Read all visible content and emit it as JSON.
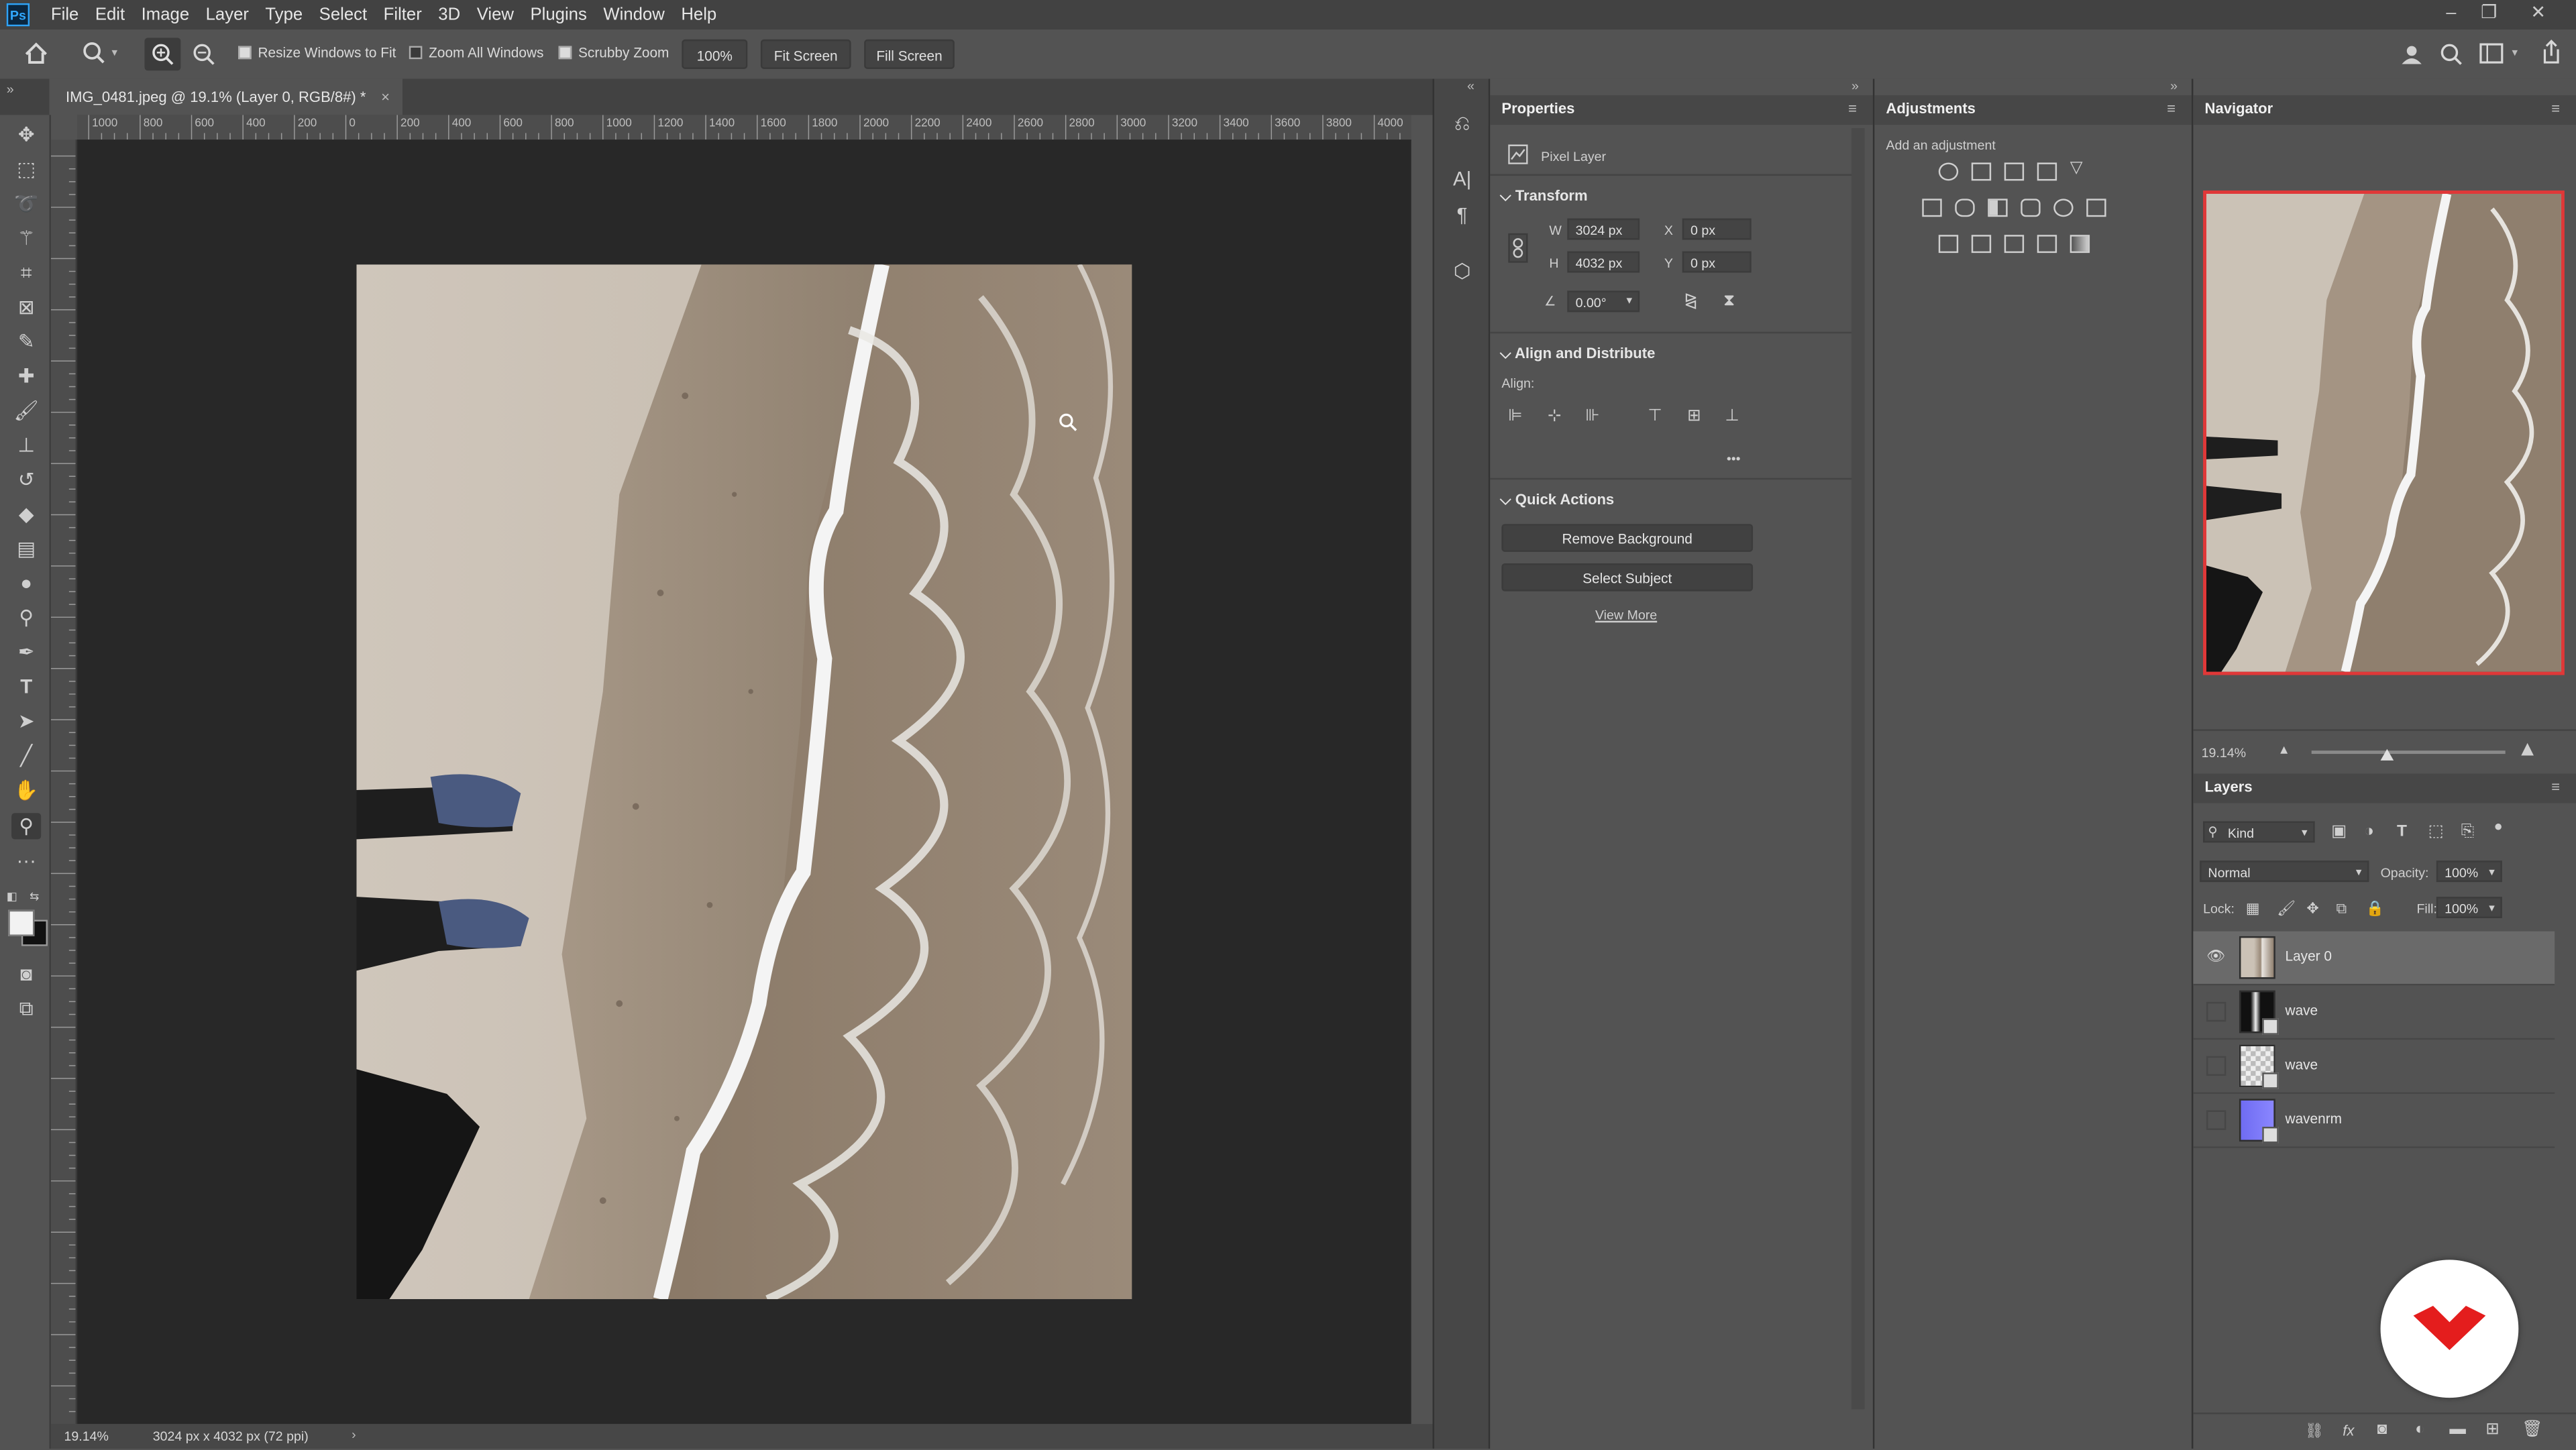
{
  "menu": [
    "File",
    "Edit",
    "Image",
    "Layer",
    "Type",
    "Select",
    "Filter",
    "3D",
    "View",
    "Plugins",
    "Window",
    "Help"
  ],
  "app_icon": "Ps",
  "options": {
    "resize_windows": "Resize Windows to Fit",
    "zoom_all": "Zoom All Windows",
    "scrubby": "Scrubby Zoom",
    "zoom_pct": "100%",
    "fit_screen": "Fit Screen",
    "fill_screen": "Fill Screen"
  },
  "document": {
    "tab_title": "IMG_0481.jpeg @ 19.1% (Layer 0, RGB/8#) *",
    "ruler_ticks": [
      "1000",
      "800",
      "600",
      "400",
      "200",
      "0",
      "200",
      "400",
      "600",
      "800",
      "1000",
      "1200",
      "1400",
      "1600",
      "1800",
      "2000",
      "2200",
      "2400",
      "2600",
      "2800",
      "3000",
      "3200",
      "3400",
      "3600",
      "3800",
      "4000"
    ],
    "zoom": "19.14%",
    "dimensions": "3024 px x 4032 px (72 ppi)"
  },
  "properties": {
    "title": "Properties",
    "kind": "Pixel Layer",
    "transform": "Transform",
    "w_label": "W",
    "w": "3024 px",
    "x_label": "X",
    "x": "0 px",
    "h_label": "H",
    "h": "4032 px",
    "y_label": "Y",
    "y": "0 px",
    "angle": "0.00°",
    "align_distribute": "Align and Distribute",
    "align_label": "Align:",
    "more": "•••",
    "quick_actions": "Quick Actions",
    "remove_bg": "Remove Background",
    "select_subject": "Select Subject",
    "view_more": "View More"
  },
  "adjustments": {
    "title": "Adjustments",
    "add": "Add an adjustment"
  },
  "navigator": {
    "title": "Navigator",
    "zoom": "19.14%"
  },
  "layers": {
    "title": "Layers",
    "filter_kind": "Kind",
    "blend_mode": "Normal",
    "opacity_label": "Opacity:",
    "opacity": "100%",
    "lock_label": "Lock:",
    "fill_label": "Fill:",
    "fill": "100%",
    "items": [
      {
        "name": "Layer 0",
        "visible": true
      },
      {
        "name": "wave",
        "visible": false
      },
      {
        "name": "wave",
        "visible": false
      },
      {
        "name": "wavenrm",
        "visible": false
      }
    ]
  }
}
